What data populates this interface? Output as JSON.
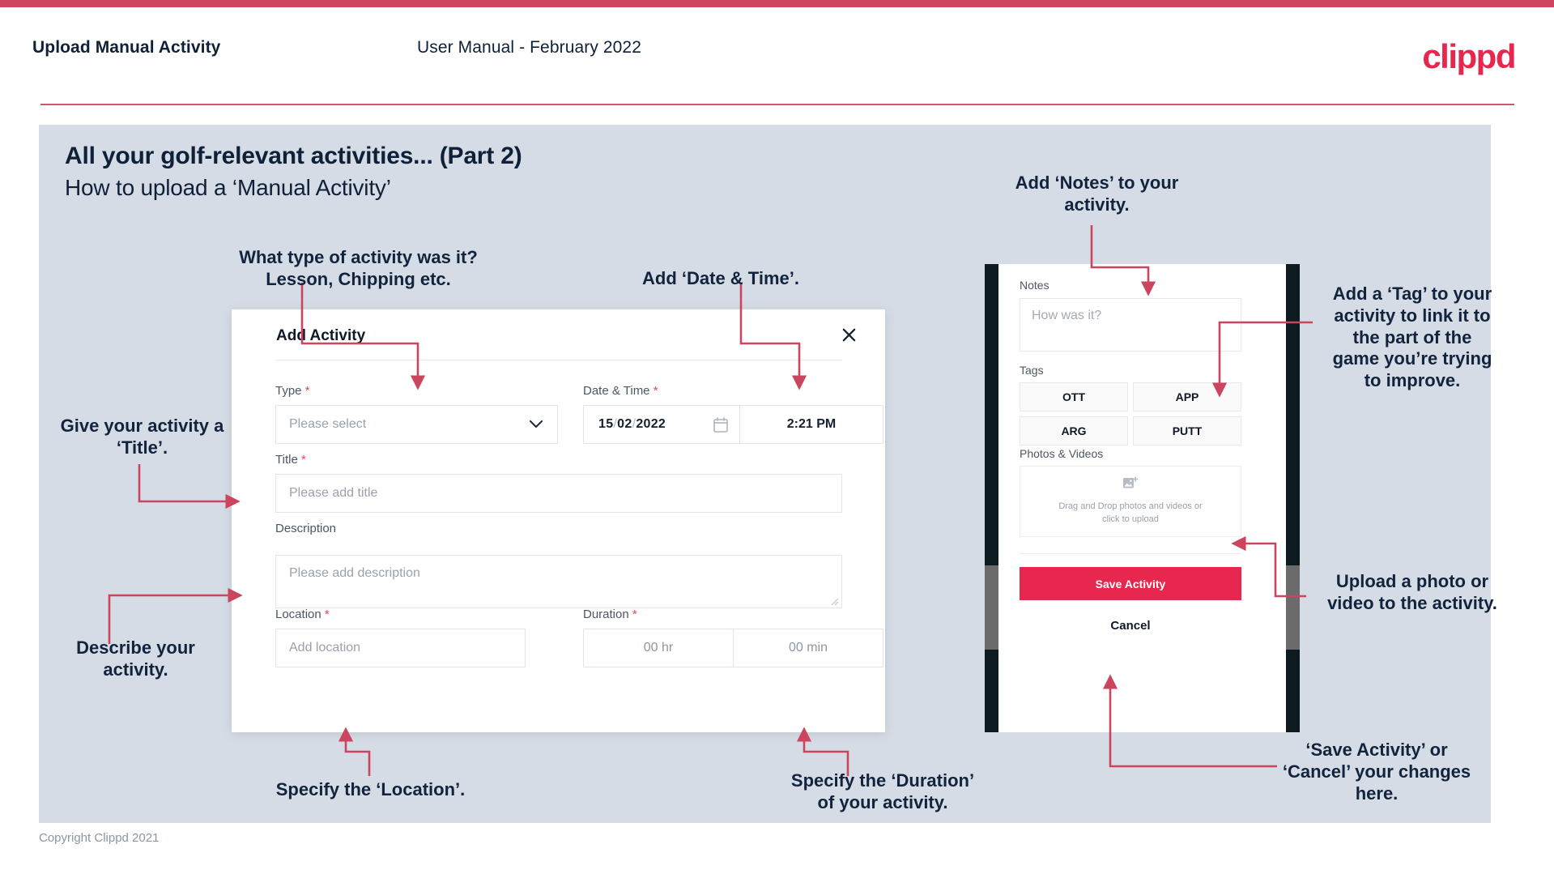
{
  "header": {
    "title": "Upload Manual Activity",
    "subtitle": "User Manual - February 2022",
    "logo": "clippd"
  },
  "slide": {
    "title": "All your golf-relevant activities... (Part 2)",
    "subtitle": "How to upload a ‘Manual Activity’"
  },
  "footer": {
    "copyright": "Copyright Clippd 2021"
  },
  "dialog": {
    "title": "Add Activity",
    "close_icon": "close-icon",
    "fields": {
      "type": {
        "label": "Type",
        "required": "*",
        "placeholder": "Please select",
        "chevron_icon": "chevron-down-icon"
      },
      "datetime": {
        "label": "Date & Time",
        "required": "*",
        "day": "15",
        "sep1": "/",
        "month": "02",
        "sep2": "/",
        "year": "2022",
        "calendar_icon": "calendar-icon",
        "time": "2:21 PM"
      },
      "title": {
        "label": "Title",
        "required": "*",
        "placeholder": "Please add title"
      },
      "description": {
        "label": "Description",
        "placeholder": "Please add description"
      },
      "location": {
        "label": "Location",
        "required": "*",
        "placeholder": "Add location"
      },
      "duration": {
        "label": "Duration",
        "required": "*",
        "hours_placeholder": "00 hr",
        "minutes_placeholder": "00 min"
      }
    }
  },
  "phone": {
    "notes": {
      "label": "Notes",
      "placeholder": "How was it?"
    },
    "tags": {
      "label": "Tags",
      "items": [
        "OTT",
        "APP",
        "ARG",
        "PUTT"
      ]
    },
    "photos": {
      "label": "Photos & Videos",
      "icon": "image-add-icon",
      "line1": "Drag and Drop photos and videos or",
      "line2": "click to upload"
    },
    "save_label": "Save Activity",
    "cancel_label": "Cancel"
  },
  "annotations": {
    "type": "What type of activity was it?\nLesson, Chipping etc.",
    "datetime": "Add ‘Date & Time’.",
    "title": "Give your activity a\n‘Title’.",
    "description": "Describe your\nactivity.",
    "location": "Specify the ‘Location’.",
    "duration": "Specify the ‘Duration’\nof your activity.",
    "notes": "Add ‘Notes’ to your\nactivity.",
    "tags": "Add a ‘Tag’ to your\nactivity to link it to\nthe part of the\ngame you’re trying\nto improve.",
    "upload": "Upload a photo or\nvideo to the activity.",
    "save": "‘Save Activity’ or\n‘Cancel’ your changes\nhere."
  },
  "colors": {
    "brand_crimson": "#e8274f",
    "top_strip": "#cf4460",
    "slide_bg": "#d6dce5",
    "arrow": "#cc455f",
    "text_dark": "#12243d"
  }
}
